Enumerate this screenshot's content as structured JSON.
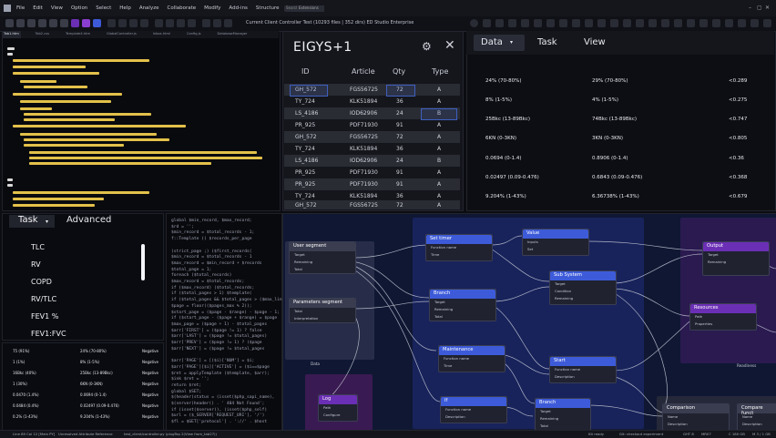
{
  "menubar": {
    "items": [
      "File",
      "Edit",
      "View",
      "Option",
      "Select",
      "Help",
      "Analyze",
      "Collaborate",
      "Modify",
      "Add-ins",
      "Structure"
    ],
    "search_label": "Search",
    "extensions_label": "Extensions"
  },
  "toolbar": {
    "title": "Current Client Controller Test (10293 files | 352 dirs) ED Studio Enterprise"
  },
  "editor": {
    "tabs": [
      "Tab1.htm",
      "Tab2.css",
      "Template4.htm",
      "GlobalController.js",
      "Inbox.html",
      "Config.js",
      "DatabaseManager"
    ]
  },
  "table_panel": {
    "title": "EIGYS+1",
    "headers": [
      "ID",
      "Article",
      "Qty",
      "Type"
    ],
    "rows": [
      [
        "GH_572",
        "FGS56725",
        "72",
        "A"
      ],
      [
        "TY_724",
        "KLK51894",
        "36",
        "A"
      ],
      [
        "LS_4186",
        "IOD62906",
        "24",
        "B"
      ],
      [
        "PR_925",
        "PDF71930",
        "91",
        "A"
      ],
      [
        "GH_572",
        "FGS56725",
        "72",
        "A"
      ],
      [
        "TY_724",
        "KLK51894",
        "36",
        "A"
      ],
      [
        "LS_4186",
        "IOD62906",
        "24",
        "B"
      ],
      [
        "PR_925",
        "PDF71930",
        "91",
        "A"
      ],
      [
        "PR_925",
        "PDF71930",
        "91",
        "A"
      ],
      [
        "TY_724",
        "KLK51894",
        "36",
        "A"
      ],
      [
        "GH_572",
        "FGS56725",
        "72",
        "A"
      ]
    ]
  },
  "data_panel": {
    "tabs": [
      "Data",
      "Task",
      "View"
    ],
    "rows": [
      [
        "24% (70-80%)",
        "29% (70-80%)",
        "<0.289"
      ],
      [
        "8% (1-5%)",
        "4% (1-5%)",
        "<0.275"
      ],
      [
        "25Bkc (13-89Bkc)",
        "74Bkc (13-89Bkc)",
        "<0.747"
      ],
      [
        "6KN (0-3KN)",
        "3KN (0-3KN)",
        "<0.805"
      ],
      [
        "0.0694 (0-1.4)",
        "0.8906 (0-1.4)",
        "<0.36"
      ],
      [
        "0.02497 (0.09-0.476)",
        "0.6843 (0.09-0.476)",
        "<0.368"
      ],
      [
        "9.204% (1-43%)",
        "6.36738% (1-43%)",
        "<0.679"
      ]
    ]
  },
  "task_panel": {
    "tabs": [
      "Task",
      "Advanced"
    ],
    "items": [
      "TLC",
      "RV",
      "COPD",
      "RV/TLC",
      "FEV1 %",
      "FEV1:FVC"
    ]
  },
  "small_table": {
    "rows": [
      [
        "75 (91%)",
        "24% (70-80%)",
        "Negative"
      ],
      [
        "1 (1%)",
        "8% (1-5%)",
        "Negative"
      ],
      [
        "16Bkc (40%)",
        "25Bkc (13-89Bkc)",
        "Negative"
      ],
      [
        "1 (30%)",
        "6KN (0-3KN)",
        "Negative"
      ],
      [
        "0.0470 (1.4%)",
        "0.0694 (0-1.4)",
        "Negative"
      ],
      [
        "0.0484 (0.4%)",
        "0.02497 (0.09-0.476)",
        "Negative"
      ],
      [
        "0.2% (1-43%)",
        "9.204% (1-43%)",
        "Negative"
      ]
    ]
  },
  "mid_code": {
    "lines": [
      "global $min_record, $max_record;",
      "$rd = '';",
      "  $min_record = $total_records - 1;",
      "  f::Template (( $records_per_page",
      "",
      "  (strict_page ;) ($first_records(",
      "  $min_record = $total_records - 1",
      "  $max_record = $min_record + $records",
      "  $total_page = 1;",
      "  foreach ($total_records)",
      "    $max_record = $total_records;",
      "    if ($max_record) ($total_records;",
      "if ($total_pages > 1) $template(",
      "if ($total_pages && $total_pages > ($max_link",
      "$page = floor(($pages_max % 2));",
      "$start_page = ($page - $range) - $page - 1;",
      "  if ($start_page - ($page + $range) = $page",
      "  $max_page = ($page + 1) - $total_pages",
      "  $arr['FIRST'] = ($page != 1) ? false",
      "  $arr['LAST'] = ($page != $total_pages)",
      "  $arr['PREV'] = ($page != 1) ? ($page",
      "  $arr['NEXT'] = ($page != $total_pages",
      "",
      "  $arr['PAGE'] = [($i)['NUM'] = $i;",
      "  $arr['PAGE'][$i]['ACTIVE'] = ($i==$page",
      "  $ret = applyTemplate ($template, $arr);",
      "  $ink $ret = '';",
      "return $ret;",
      "global $SET;",
      "  $(header)status = (isset($php_sapi_name),",
      "  $(server)header() . ' 404 Not Found';",
      "  if (isset($server)), (isset($php_self)",
      "  $url = ($_SERVER['REQUEST_URI'], '/')",
      "  $fl = $GET['protocol'] . '://' . $host"
    ]
  },
  "graph": {
    "nodes": {
      "user_segment": {
        "title": "User segment",
        "ports": [
          "Target",
          "Remaining",
          "Total"
        ]
      },
      "params_segment": {
        "title": "Parameters segment",
        "ports": [
          "Total",
          "Interpretation"
        ]
      },
      "set_timer": {
        "title": "Set timer",
        "ports": [
          "Function name",
          "Time"
        ]
      },
      "value": {
        "title": "Value",
        "ports": [
          "Inputs",
          "Set"
        ]
      },
      "output": {
        "title": "Output",
        "ports": [
          "Target",
          "Remaining"
        ]
      },
      "sub_system": {
        "title": "Sub System",
        "ports": [
          "Target",
          "Condition",
          "Remaining"
        ]
      },
      "branch1": {
        "title": "Branch",
        "ports": [
          "Target",
          "Remaining",
          "Total"
        ]
      },
      "resources": {
        "title": "Resources",
        "ports": [
          "Path",
          "Properties"
        ]
      },
      "maintenance": {
        "title": "Maintenance",
        "ports": [
          "Function name",
          "Time"
        ]
      },
      "start": {
        "title": "Start",
        "ports": [
          "Function name",
          "Description"
        ]
      },
      "log": {
        "title": "Log",
        "ports": [
          "Path",
          "Configure"
        ]
      },
      "if_node": {
        "title": "If",
        "ports": [
          "Function name",
          "Description"
        ]
      },
      "branch2": {
        "title": "Branch",
        "ports": [
          "Target",
          "Remaining",
          "Total"
        ]
      },
      "comparison": {
        "title": "Comparison",
        "ports": [
          "Name",
          "Description"
        ]
      },
      "compare_func": {
        "title": "Compare funct",
        "ports": [
          "Name",
          "Description"
        ]
      }
    },
    "group_labels": {
      "data": "Data",
      "readiness": "Readiness"
    }
  },
  "statusbar": {
    "left": "Line 89 Col 12 [Main PY]",
    "middle1": "Unresolved Attribute Reference",
    "middle2": "test_client/controller.py (plugTap 2(View from_tab27))",
    "right1": "Kit ready",
    "right2": "Git: checkout experiment",
    "right3": "GHT 8",
    "right4": "MR07",
    "right5": "C 180 GB",
    "right6": "M 3 / 1 GB"
  },
  "colors": {
    "accent_blue": "#3d5bd9",
    "accent_purple": "#6b2fb5",
    "highlight": "#3e5fbf"
  }
}
